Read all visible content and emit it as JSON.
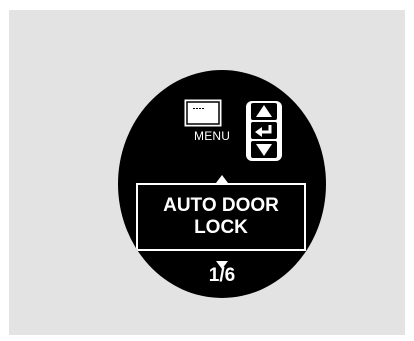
{
  "display": {
    "menu_label": "MENU",
    "item_line_1": "AUTO DOOR",
    "item_line_2": "LOCK",
    "page_indicator": "1/6"
  },
  "icons": {
    "menu": "menu-screen-icon",
    "up": "triangle-up-icon",
    "enter": "enter-return-icon",
    "down": "triangle-down-icon"
  },
  "colors": {
    "background_panel": "#e3e3e3",
    "display": "#000000",
    "foreground": "#ffffff"
  }
}
